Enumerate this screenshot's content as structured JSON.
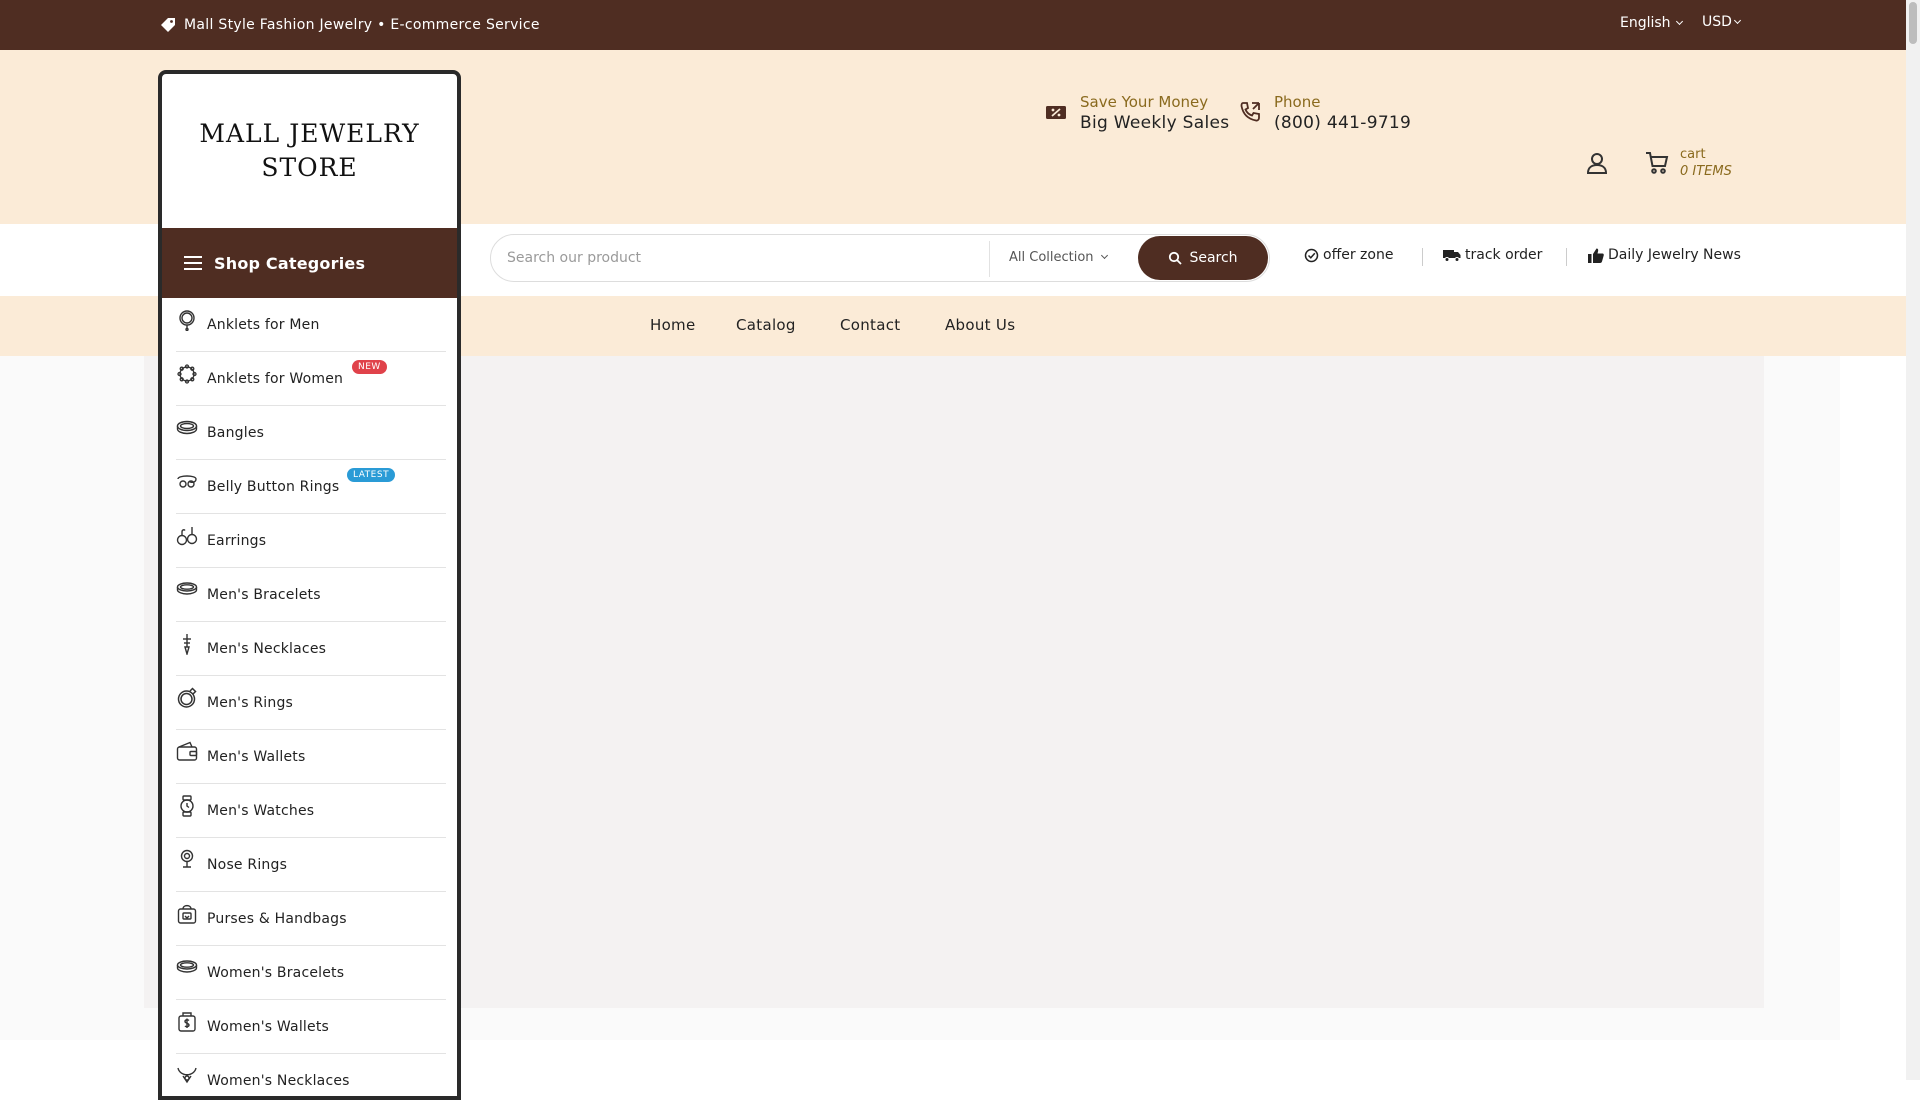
{
  "topbar": {
    "promo": "Mall Style Fashion Jewelry • E-commerce Service",
    "language": "English",
    "currency": "USD"
  },
  "header": {
    "logo": "MALL JEWELRY STORE",
    "savings_label": "Save Your Money",
    "savings_value": "Big Weekly Sales",
    "phone_label": "Phone",
    "phone_value": "(800) 441-9719",
    "cart_label": "cart",
    "cart_count": "0 ITEMS"
  },
  "search": {
    "placeholder": "Search our product",
    "collection": "All Collection",
    "button": "Search"
  },
  "quick_links": {
    "offer": "offer zone",
    "track": "track order",
    "news": "Daily Jewelry News"
  },
  "nav": {
    "home": "Home",
    "catalog": "Catalog",
    "contact": "Contact",
    "about": "About Us"
  },
  "categories": {
    "heading": "Shop Categories",
    "items": [
      {
        "label": "Anklets for Men",
        "icon": "anklet-icon"
      },
      {
        "label": "Anklets for Women",
        "icon": "anklet-beads-icon",
        "badge": "NEW"
      },
      {
        "label": "Bangles",
        "icon": "bangle-icon"
      },
      {
        "label": "Belly Button Rings",
        "icon": "belly-ring-icon",
        "badge": "LATEST"
      },
      {
        "label": "Earrings",
        "icon": "earrings-icon"
      },
      {
        "label": "Men's Bracelets",
        "icon": "bracelet-icon"
      },
      {
        "label": "Men's Necklaces",
        "icon": "necklace-icon"
      },
      {
        "label": "Men's Rings",
        "icon": "ring-icon"
      },
      {
        "label": "Men's Wallets",
        "icon": "wallet-icon"
      },
      {
        "label": "Men's Watches",
        "icon": "watch-icon"
      },
      {
        "label": "Nose Rings",
        "icon": "nose-ring-icon"
      },
      {
        "label": "Purses & Handbags",
        "icon": "purse-icon"
      },
      {
        "label": "Women's Bracelets",
        "icon": "bracelet-icon"
      },
      {
        "label": "Women's Wallets",
        "icon": "wallet-dollar-icon"
      },
      {
        "label": "Women's Necklaces",
        "icon": "necklace-icon"
      }
    ]
  },
  "colors": {
    "brand_dark": "#4f2d22",
    "cream": "#fbebd7",
    "gold_text": "#8a6a1e",
    "badge_new": "#e0424a",
    "badge_latest": "#2a9bd6"
  }
}
